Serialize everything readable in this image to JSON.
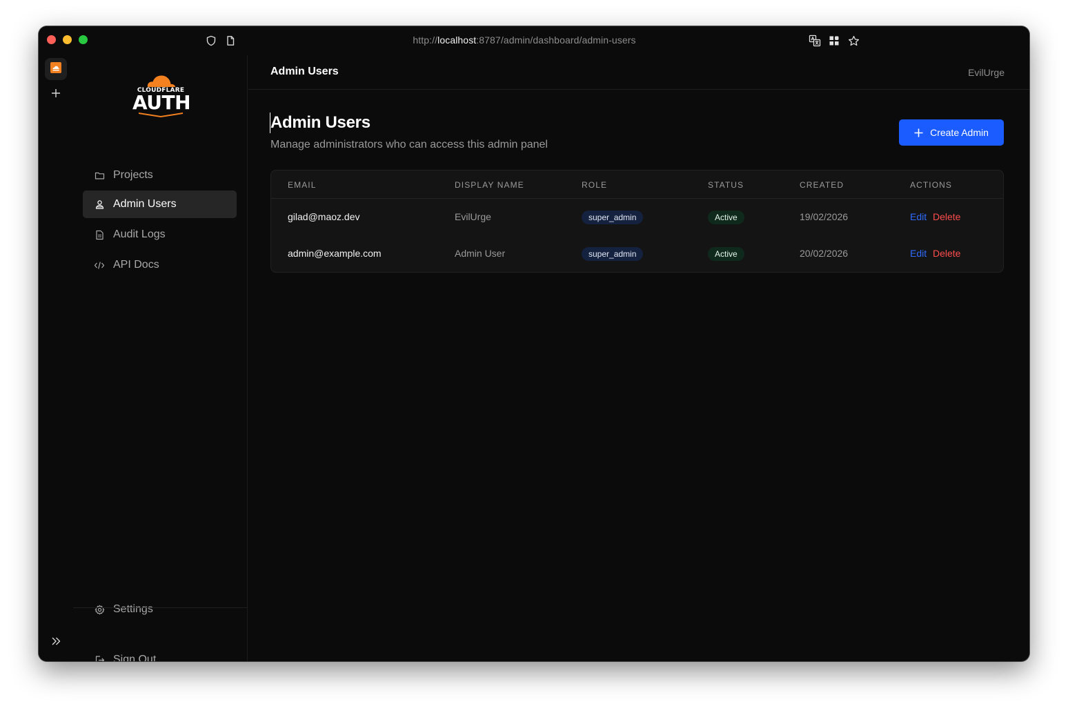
{
  "browser": {
    "url_prefix": "http://",
    "url_host": "localhost",
    "url_rest": ":8787/admin/dashboard/admin-users"
  },
  "logo": {
    "top_word": "CLOUDFLARE",
    "main_word": "AUTH"
  },
  "sidebar": {
    "items": [
      {
        "label": "Projects",
        "icon": "folder-icon"
      },
      {
        "label": "Admin Users",
        "icon": "users-icon",
        "active": true
      },
      {
        "label": "Audit Logs",
        "icon": "document-icon"
      },
      {
        "label": "API Docs",
        "icon": "code-icon"
      }
    ],
    "settings_label": "Settings",
    "signout_label": "Sign Out"
  },
  "header": {
    "title": "Admin Users",
    "user": "EvilUrge"
  },
  "main": {
    "title": "Admin Users",
    "subtitle": "Manage administrators who can access this admin panel",
    "create_button": "Create Admin"
  },
  "table": {
    "columns": [
      "EMAIL",
      "DISPLAY NAME",
      "ROLE",
      "STATUS",
      "CREATED",
      "ACTIONS"
    ],
    "rows": [
      {
        "email": "gilad@maoz.dev",
        "display_name": "EvilUrge",
        "role": "super_admin",
        "status": "Active",
        "created": "19/02/2026",
        "edit": "Edit",
        "delete": "Delete"
      },
      {
        "email": "admin@example.com",
        "display_name": "Admin User",
        "role": "super_admin",
        "status": "Active",
        "created": "20/02/2026",
        "edit": "Edit",
        "delete": "Delete"
      }
    ]
  },
  "colors": {
    "accent": "#1a5cff",
    "danger": "#ff4d4d",
    "brand_orange": "#f48120",
    "background": "#0b0b0b"
  }
}
